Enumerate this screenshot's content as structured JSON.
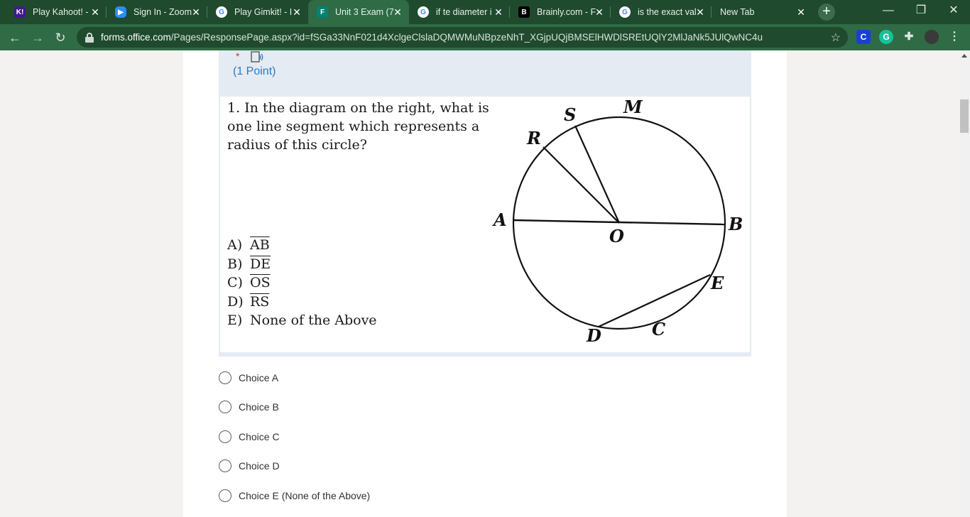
{
  "browser": {
    "tabs": [
      {
        "title": "Play Kahoot! - ",
        "favicon": "kahoot-icon",
        "color": "#46178f"
      },
      {
        "title": "Sign In - Zoom",
        "favicon": "zoom-icon",
        "color": "#2d8cff"
      },
      {
        "title": "Play Gimkit! - I",
        "favicon": "google-icon",
        "color": "#ffffff"
      },
      {
        "title": "Unit 3 Exam (7",
        "favicon": "forms-icon",
        "color": "#008272",
        "active": true
      },
      {
        "title": "if te diameter i",
        "favicon": "google-icon",
        "color": "#ffffff"
      },
      {
        "title": "Brainly.com - F",
        "favicon": "brainly-icon",
        "color": "#000000"
      },
      {
        "title": "is the exact val",
        "favicon": "google-icon",
        "color": "#ffffff"
      },
      {
        "title": "New Tab",
        "favicon": "",
        "color": ""
      }
    ],
    "url_host": "forms.office.com",
    "url_path": "/Pages/ResponsePage.aspx?id=fSGa33NnF021d4XclgeClslaDQMWMuNBpzeNhT_XGjpUQjBMSElHWDlSREtUQlY2MlJaNk5JUlQwNC4u",
    "theme_dark": "#1f4a2e",
    "theme": "#2f6b44"
  },
  "question": {
    "required_mark": "*",
    "points": "(1 Point)",
    "text": "1.  In the diagram on the right, what is one line segment which represents a radius of this circle?",
    "options": [
      {
        "letter": "A)",
        "text": "AB",
        "segment": true
      },
      {
        "letter": "B)",
        "text": "DE",
        "segment": true
      },
      {
        "letter": "C)",
        "text": "OS",
        "segment": true
      },
      {
        "letter": "D)",
        "text": "RS",
        "segment": true
      },
      {
        "letter": "E)",
        "text": "None of the Above",
        "segment": false
      }
    ],
    "diagram_labels": {
      "A": "A",
      "B": "B",
      "O": "O",
      "R": "R",
      "S": "S",
      "M": "M",
      "E": "E",
      "D": "D",
      "C": "C"
    }
  },
  "choices": [
    "Choice A",
    "Choice B",
    "Choice C",
    "Choice D",
    "Choice E (None of the Above)"
  ],
  "accent": "#2a78c5"
}
